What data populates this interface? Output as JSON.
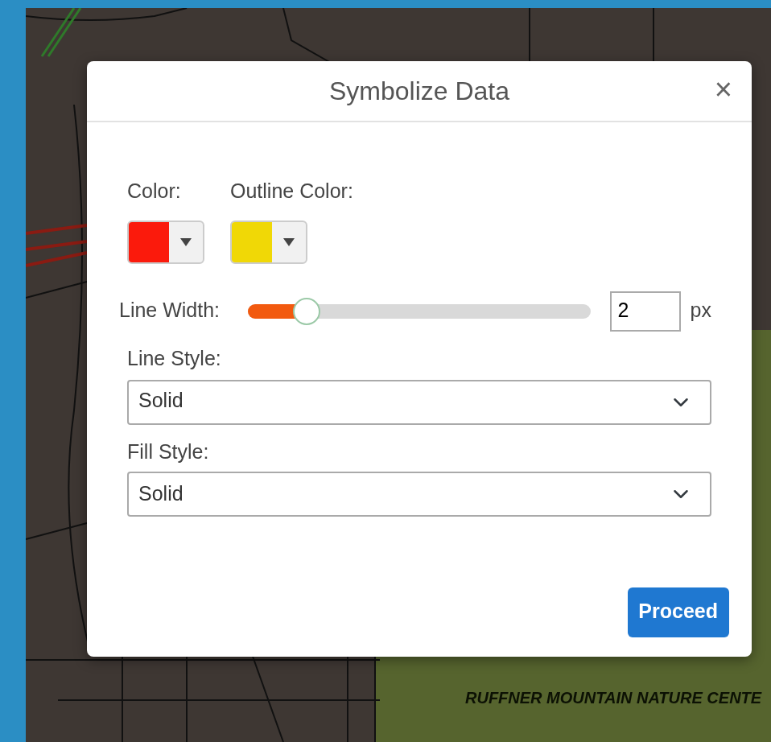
{
  "map": {
    "label": "RUFFNER MOUNTAIN NATURE CENTE"
  },
  "dialog": {
    "title": "Symbolize Data",
    "close": "×",
    "color_pickers": [
      {
        "label": "Color:",
        "color": "#fb1a0c"
      },
      {
        "label": "Outline Color:",
        "color": "#f0d806"
      }
    ],
    "line_width": {
      "label": "Line Width:",
      "level": 0.17,
      "value": "2",
      "unit": "px"
    },
    "selects": [
      {
        "label": "Line Style:",
        "value": "Solid"
      },
      {
        "label": "Fill Style:",
        "value": "Solid"
      }
    ],
    "buttons": [
      "Proceed"
    ]
  }
}
